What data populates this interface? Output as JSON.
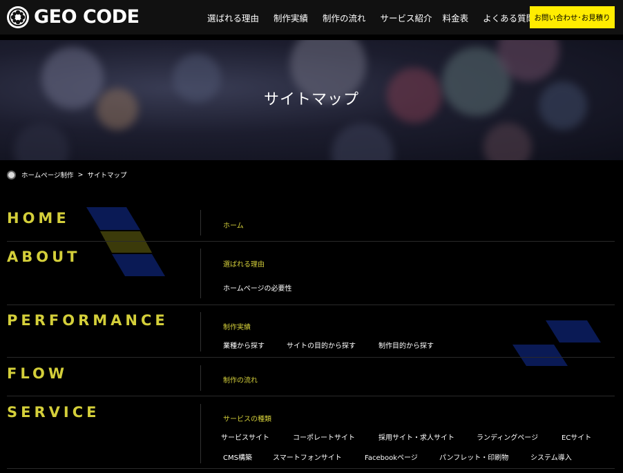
{
  "header": {
    "logo_text": "GEO CODE",
    "nav": [
      "選ばれる理由",
      "制作実績",
      "制作の流れ",
      "サービス紹介",
      "料金表",
      "よくある質問"
    ],
    "cta_label": "お問い合わせ･お見積り"
  },
  "hero": {
    "title": "サイトマップ"
  },
  "breadcrumb": {
    "home": "ホームページ制作",
    "sep": ">",
    "current": "サイトマップ"
  },
  "sitemap": {
    "home": {
      "title": "HOME",
      "cat": "ホーム"
    },
    "about": {
      "title": "ABOUT",
      "cat": "選ばれる理由",
      "links": [
        "ホームページの必要性"
      ]
    },
    "performance": {
      "title": "PERFORMANCE",
      "cat": "制作実績",
      "links": [
        "業種から探す",
        "サイトの目的から探す",
        "制作目的から探す"
      ]
    },
    "flow": {
      "title": "FLOW",
      "cat": "制作の流れ"
    },
    "service": {
      "title": "SERVICE",
      "cat": "サービスの種類",
      "links_row1": [
        "サービスサイト",
        "コーポレートサイト",
        "採用サイト・求人サイト",
        "ランディングページ",
        "ECサイト"
      ],
      "links_row2": [
        "CMS構築",
        "スマートフォンサイト",
        "Facebookページ",
        "パンフレット・印刷物",
        "システム導入"
      ]
    }
  },
  "colors": {
    "accent": "#d4cf3a",
    "cta": "#ffec00",
    "background": "#000000"
  }
}
